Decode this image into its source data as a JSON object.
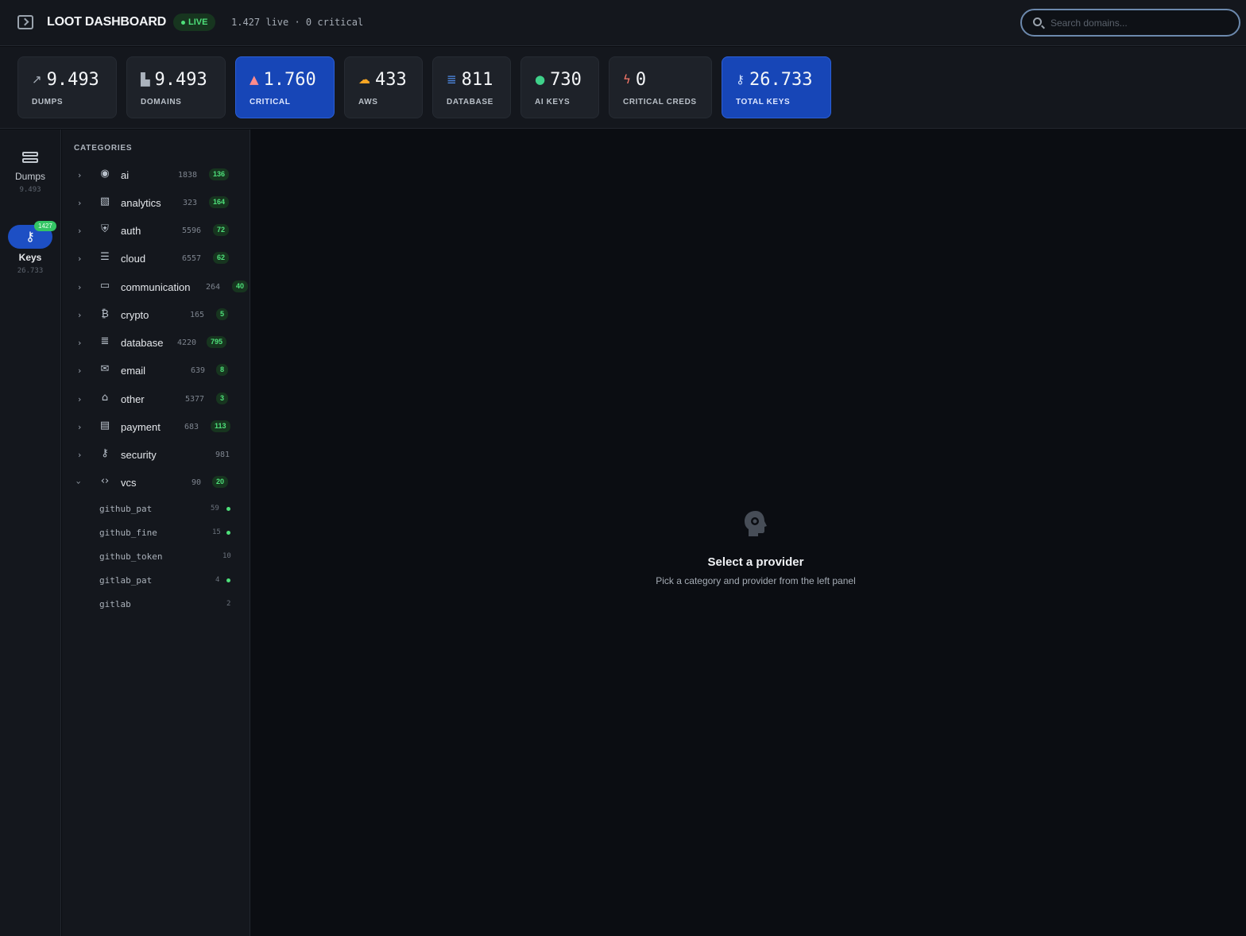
{
  "header": {
    "title": "LOOT DASHBOARD",
    "live_label": "LIVE",
    "status": "1.427 live · 0 critical",
    "search_placeholder": "Search domains..."
  },
  "stats": [
    {
      "value": "9.493",
      "label": "DUMPS",
      "icon": "trend-up-icon",
      "active": false
    },
    {
      "value": "9.493",
      "label": "DOMAINS",
      "icon": "building-icon",
      "active": false
    },
    {
      "value": "1.760",
      "label": "CRITICAL",
      "icon": "warning-triangle-icon",
      "active": true
    },
    {
      "value": "433",
      "label": "AWS",
      "icon": "cloud-icon",
      "active": false
    },
    {
      "value": "811",
      "label": "DATABASE",
      "icon": "database-icon",
      "active": false
    },
    {
      "value": "730",
      "label": "AI KEYS",
      "icon": "brain-icon",
      "active": false
    },
    {
      "value": "0",
      "label": "CRITICAL CREDS",
      "icon": "bolt-icon",
      "active": false
    },
    {
      "value": "26.733",
      "label": "TOTAL KEYS",
      "icon": "key-icon",
      "active": true
    }
  ],
  "rail": {
    "dumps": {
      "label": "Dumps",
      "count": "9.493"
    },
    "keys": {
      "label": "Keys",
      "count": "26.733",
      "badge": "1427"
    }
  },
  "categories_title": "CATEGORIES",
  "categories": [
    {
      "name": "ai",
      "count": "1838",
      "badge": "136",
      "icon": "brain-icon",
      "expanded": false
    },
    {
      "name": "analytics",
      "count": "323",
      "badge": "164",
      "icon": "chart-icon",
      "expanded": false
    },
    {
      "name": "auth",
      "count": "5596",
      "badge": "72",
      "icon": "shield-icon",
      "expanded": false
    },
    {
      "name": "cloud",
      "count": "6557",
      "badge": "62",
      "icon": "server-icon",
      "expanded": false
    },
    {
      "name": "communication",
      "count": "264",
      "badge": "40",
      "icon": "chat-icon",
      "expanded": false
    },
    {
      "name": "crypto",
      "count": "165",
      "badge": "5",
      "icon": "bitcoin-icon",
      "expanded": false
    },
    {
      "name": "database",
      "count": "4220",
      "badge": "795",
      "icon": "database-icon",
      "expanded": false
    },
    {
      "name": "email",
      "count": "639",
      "badge": "8",
      "icon": "mail-icon",
      "expanded": false
    },
    {
      "name": "other",
      "count": "5377",
      "badge": "3",
      "icon": "bank-icon",
      "expanded": false
    },
    {
      "name": "payment",
      "count": "683",
      "badge": "113",
      "icon": "card-icon",
      "expanded": false
    },
    {
      "name": "security",
      "count": "981",
      "badge": "",
      "icon": "key-icon",
      "expanded": false
    },
    {
      "name": "vcs",
      "count": "90",
      "badge": "20",
      "icon": "code-icon",
      "expanded": true
    }
  ],
  "vcs_providers": [
    {
      "name": "github_pat",
      "count": "59",
      "dot": true
    },
    {
      "name": "github_fine",
      "count": "15",
      "dot": true
    },
    {
      "name": "github_token",
      "count": "10",
      "dot": false
    },
    {
      "name": "gitlab_pat",
      "count": "4",
      "dot": true
    },
    {
      "name": "gitlab",
      "count": "2",
      "dot": false
    }
  ],
  "empty_state": {
    "title": "Select a provider",
    "subtitle": "Pick a category and provider from the left panel"
  },
  "colors": {
    "accent": "#1746b7",
    "live_green": "#4ee07a",
    "background": "#0b0d12",
    "panel": "#14171d"
  }
}
